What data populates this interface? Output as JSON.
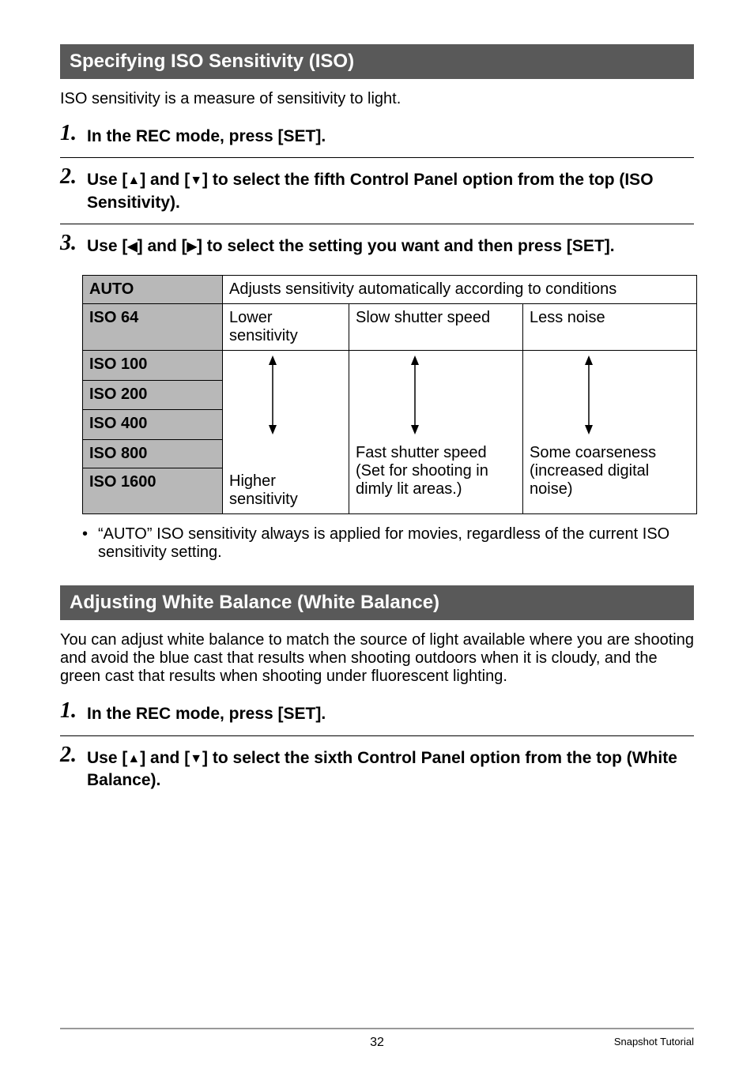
{
  "section1": {
    "title": "Specifying ISO Sensitivity (ISO)",
    "intro": "ISO sensitivity is a measure of sensitivity to light.",
    "steps": [
      {
        "num": "1.",
        "text_before": "In the REC mode, press [SET]."
      },
      {
        "num": "2.",
        "text_before": "Use [",
        "tri1": "▲",
        "text_mid1": "] and [",
        "tri2": "▼",
        "text_after": "] to select the fifth Control Panel option from the top (ISO Sensitivity)."
      },
      {
        "num": "3.",
        "text_before": "Use [",
        "tri1": "◀",
        "text_mid1": "] and [",
        "tri2": "▶",
        "text_after": "] to select the setting you want and then press [SET]."
      }
    ],
    "table": {
      "auto_label": "AUTO",
      "auto_desc": "Adjusts sensitivity automatically according to conditions",
      "rows": [
        "ISO 64",
        "ISO 100",
        "ISO 200",
        "ISO 400",
        "ISO 800",
        "ISO 1600"
      ],
      "sens_top": "Lower sensitivity",
      "sens_bot": "Higher sensitivity",
      "shut_top": "Slow shutter speed",
      "shut_bot": "Fast shutter speed (Set for shooting in dimly lit areas.)",
      "noise_top": "Less noise",
      "noise_bot": "Some coarseness (increased digital noise)"
    },
    "note": "“AUTO” ISO sensitivity always is applied for movies, regardless of the current ISO sensitivity setting."
  },
  "section2": {
    "title": "Adjusting White Balance (White Balance)",
    "intro": "You can adjust white balance to match the source of light available where you are shooting and avoid the blue cast that results when shooting outdoors when it is cloudy, and the green cast that results when shooting under fluorescent lighting.",
    "steps": [
      {
        "num": "1.",
        "text_before": "In the REC mode, press [SET]."
      },
      {
        "num": "2.",
        "text_before": "Use [",
        "tri1": "▲",
        "text_mid1": "] and [",
        "tri2": "▼",
        "text_after": "] to select the sixth Control Panel option from the top (White Balance)."
      }
    ]
  },
  "footer": {
    "page": "32",
    "label": "Snapshot Tutorial"
  }
}
